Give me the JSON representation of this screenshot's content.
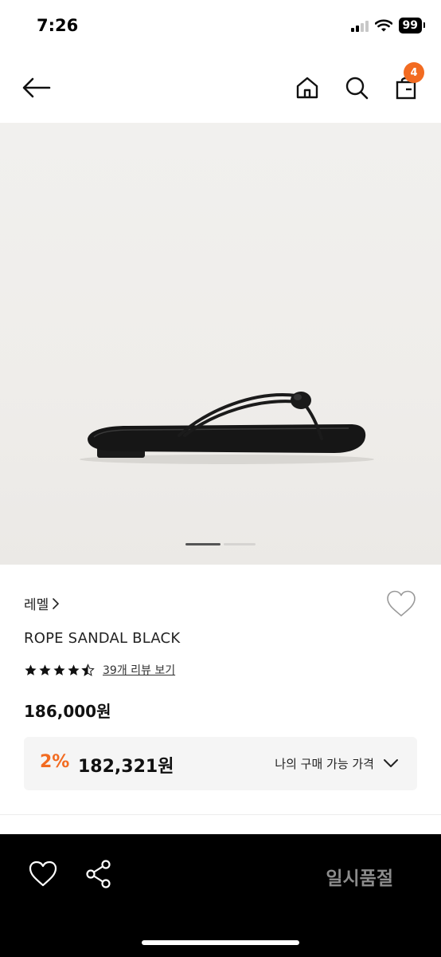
{
  "status_bar": {
    "time": "7:26",
    "battery": "99",
    "icons": [
      "signal-icon",
      "wifi-icon",
      "battery-icon"
    ]
  },
  "nav": {
    "icons": [
      "back-arrow-icon",
      "home-icon",
      "search-icon",
      "shopping-bag-icon"
    ],
    "cart_badge": "4",
    "badge_color": "#f26b21"
  },
  "product": {
    "image": "sandal-photo",
    "carousel": {
      "current": 1,
      "total": 2
    },
    "brand": "레멜",
    "title": "ROPE SANDAL BLACK",
    "rating": 4.5,
    "review_text": "39개 리뷰 보기",
    "price": "186,000원"
  },
  "member_price": {
    "discount_rate": "2%",
    "discount_price": "182,321원",
    "label": "나의 구매 가능 가격",
    "accent": "#f26b21"
  },
  "bottom_bar": {
    "icons": [
      "heart-icon",
      "share-icon"
    ],
    "status": "일시품절"
  }
}
